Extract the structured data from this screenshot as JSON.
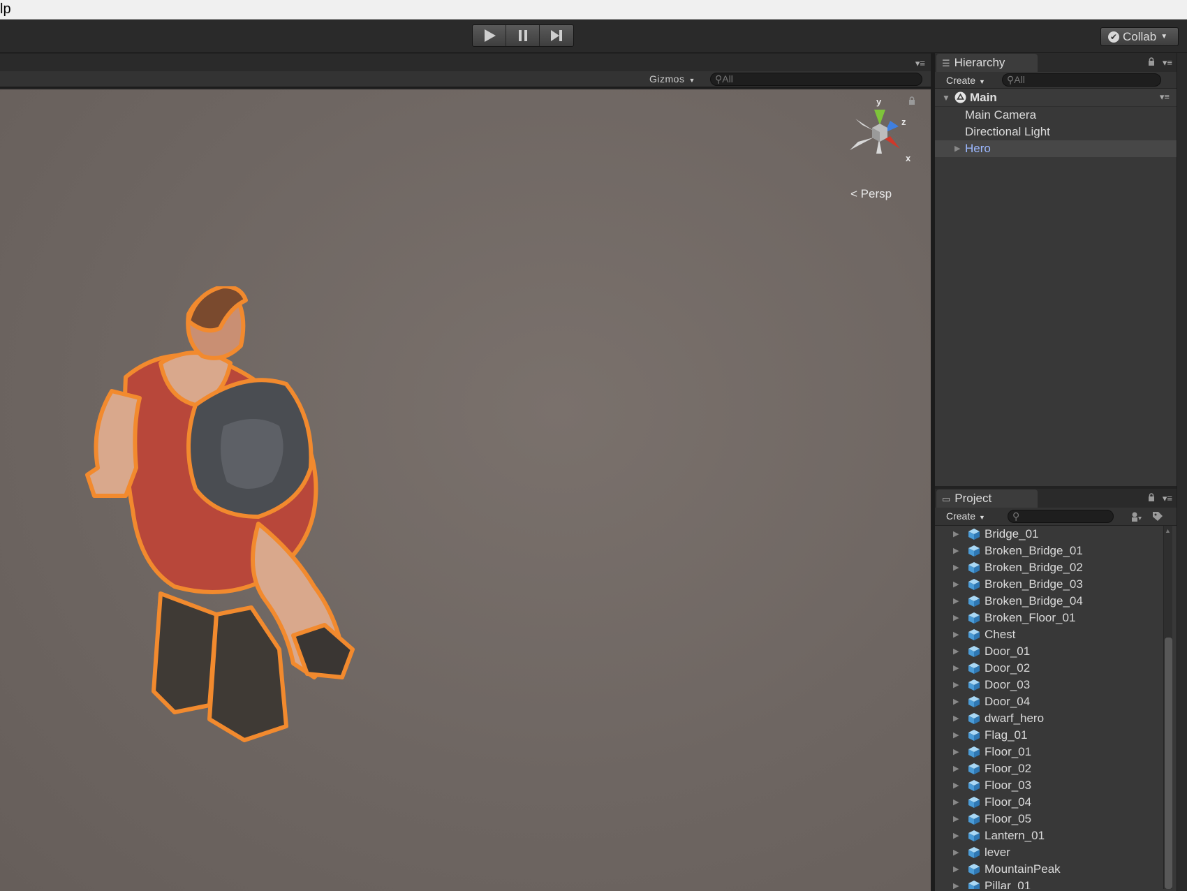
{
  "menubar": {
    "label": "lp"
  },
  "toolbar": {
    "play_icon": "play-icon",
    "pause_icon": "pause-icon",
    "step_icon": "step-icon",
    "collab_label": "Collab"
  },
  "scene": {
    "gizmos_label": "Gizmos",
    "search_placeholder": "All",
    "axis_labels": {
      "y": "y",
      "z": "z",
      "x": "x"
    },
    "projection_label": "Persp",
    "colors": {
      "background": "#6e6662",
      "selection_outline": "#f28a2e"
    }
  },
  "hierarchy": {
    "tab_label": "Hierarchy",
    "create_label": "Create",
    "search_placeholder": "All",
    "scene_name": "Main",
    "items": [
      {
        "label": "Main Camera",
        "selected": false,
        "has_children": false
      },
      {
        "label": "Directional Light",
        "selected": false,
        "has_children": false
      },
      {
        "label": "Hero",
        "selected": true,
        "has_children": true
      }
    ]
  },
  "project": {
    "tab_label": "Project",
    "create_label": "Create",
    "search_placeholder": "",
    "items": [
      "Bridge_01",
      "Broken_Bridge_01",
      "Broken_Bridge_02",
      "Broken_Bridge_03",
      "Broken_Bridge_04",
      "Broken_Floor_01",
      "Chest",
      "Door_01",
      "Door_02",
      "Door_03",
      "Door_04",
      "dwarf_hero",
      "Flag_01",
      "Floor_01",
      "Floor_02",
      "Floor_03",
      "Floor_04",
      "Floor_05",
      "Lantern_01",
      "lever",
      "MountainPeak",
      "Pillar_01"
    ]
  }
}
